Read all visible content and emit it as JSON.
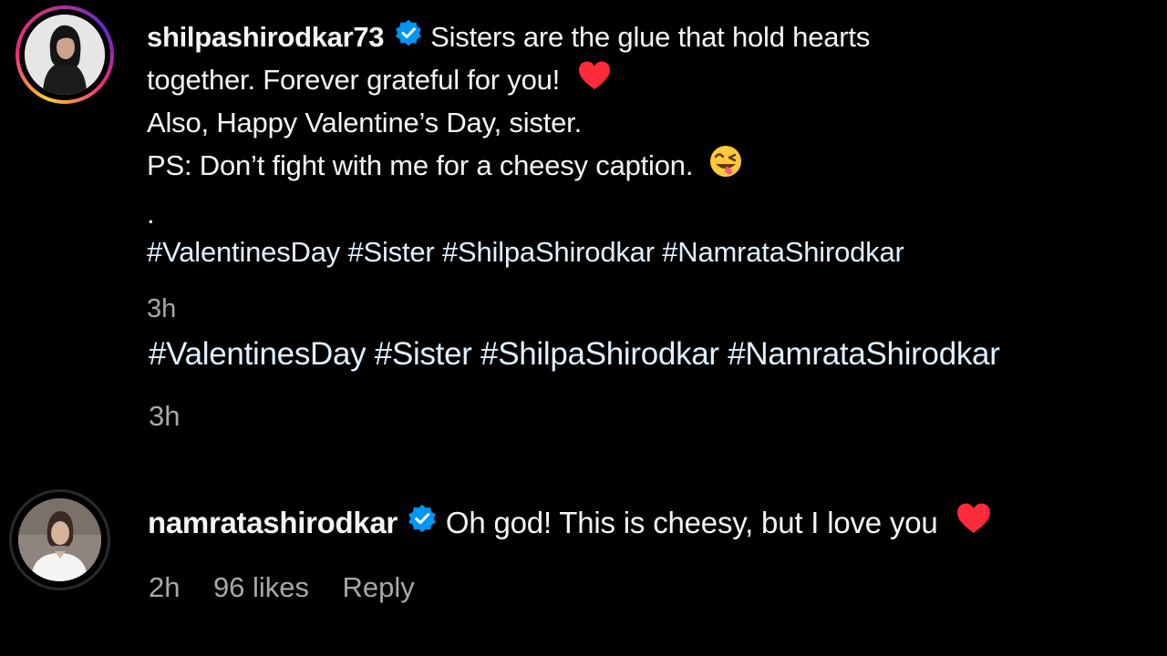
{
  "comments": [
    {
      "username": "shilpashirodkar73",
      "verified": true,
      "lines": [
        "Sisters are the glue that hold hearts",
        "together. Forever grateful for you!",
        "Also, Happy Valentine’s Day, sister.",
        "PS: Don’t fight with me for a cheesy caption.",
        "."
      ],
      "hashtags": "#ValentinesDay #Sister #ShilpaShirodkar #NamrataShirodkar",
      "time": "3h"
    },
    {
      "hashtags": "#ValentinesDay #Sister #ShilpaShirodkar #NamrataShirodkar",
      "time": "3h"
    },
    {
      "username": "namratashirodkar",
      "verified": true,
      "text": "Oh god! This is cheesy, but I love you",
      "time": "2h",
      "likes": "96 likes",
      "reply_label": "Reply"
    }
  ],
  "icons": {
    "verified": "verified-badge-icon",
    "heart": "red-heart-emoji-icon",
    "tongue": "face-savoring-food-emoji-icon"
  },
  "colors": {
    "background": "#000000",
    "text": "#f5f5f5",
    "secondary": "#a8a8a8",
    "verified": "#0095f6",
    "heart": "#ff3040"
  }
}
